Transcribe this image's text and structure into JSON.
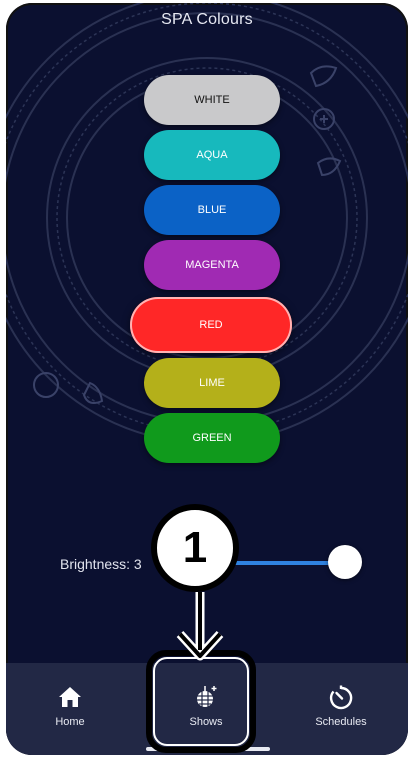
{
  "screen": {
    "title": "SPA Colours"
  },
  "colors": [
    {
      "label": "WHITE",
      "bg": "#c9c9cb",
      "fg": "#111111",
      "selected": false
    },
    {
      "label": "AQUA",
      "bg": "#17b9bd",
      "fg": "#ffffff",
      "selected": false
    },
    {
      "label": "BLUE",
      "bg": "#0b62c6",
      "fg": "#ffffff",
      "selected": false
    },
    {
      "label": "MAGENTA",
      "bg": "#a02ab3",
      "fg": "#ffffff",
      "selected": false
    },
    {
      "label": "RED",
      "bg": "#ff2727",
      "fg": "#ffffff",
      "selected": true
    },
    {
      "label": "LIME",
      "bg": "#b4b01a",
      "fg": "#ffffff",
      "selected": false
    },
    {
      "label": "GREEN",
      "bg": "#109a1c",
      "fg": "#ffffff",
      "selected": false
    }
  ],
  "brightness": {
    "label": "Brightness: 3",
    "value": 1.0
  },
  "callout": {
    "number": "1"
  },
  "nav": {
    "items": [
      {
        "label": "Home",
        "icon": "home-icon"
      },
      {
        "label": "Shows",
        "icon": "disco-ball-icon"
      },
      {
        "label": "Schedules",
        "icon": "timer-icon"
      }
    ],
    "active": "Shows"
  },
  "theme": {
    "background": "#0b1030",
    "nav_bg": "#222845",
    "accent": "#2f82e0"
  }
}
